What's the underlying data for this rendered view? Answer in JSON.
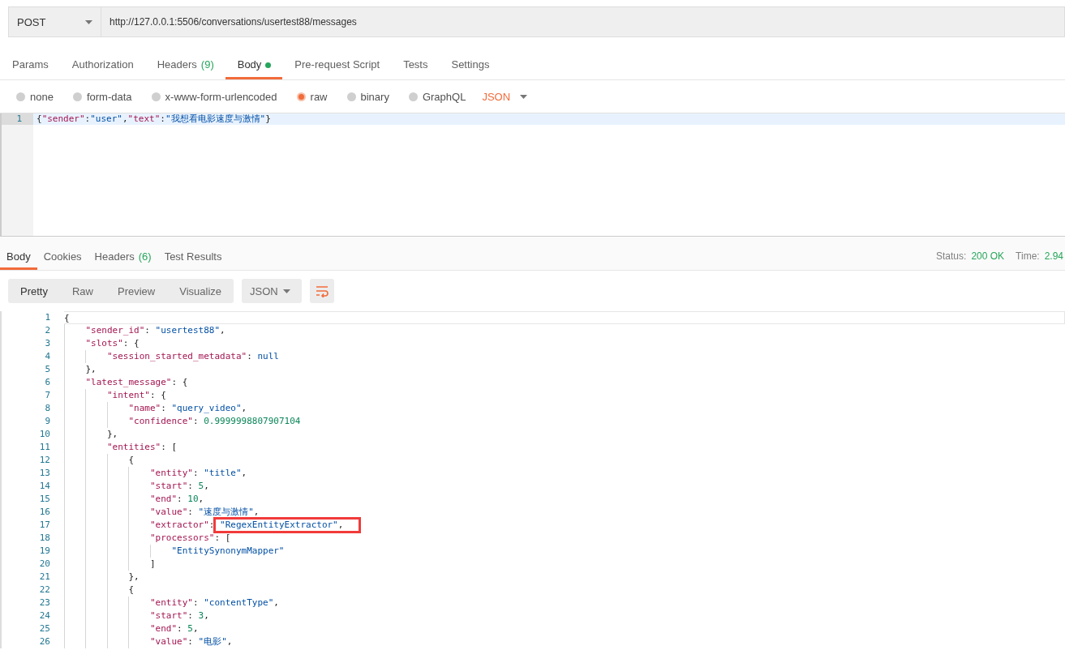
{
  "request": {
    "method": "POST",
    "url": "http://127.0.0.1:5506/conversations/usertest88/messages"
  },
  "request_tabs": [
    {
      "label": "Params",
      "selected": false
    },
    {
      "label": "Authorization",
      "selected": false
    },
    {
      "label": "Headers",
      "count": "(9)",
      "selected": false
    },
    {
      "label": "Body",
      "indicator": true,
      "selected": true
    },
    {
      "label": "Pre-request Script",
      "selected": false
    },
    {
      "label": "Tests",
      "selected": false
    },
    {
      "label": "Settings",
      "selected": false
    }
  ],
  "body_types": [
    {
      "label": "none",
      "selected": false
    },
    {
      "label": "form-data",
      "selected": false
    },
    {
      "label": "x-www-form-urlencoded",
      "selected": false
    },
    {
      "label": "raw",
      "selected": true
    },
    {
      "label": "binary",
      "selected": false
    },
    {
      "label": "GraphQL",
      "selected": false
    }
  ],
  "body_format": "JSON",
  "request_body": [
    {
      "number": "1",
      "tokens": [
        {
          "kind": "punct",
          "text": "{"
        },
        {
          "kind": "key",
          "text": "\"sender\""
        },
        {
          "kind": "punct",
          "text": ":"
        },
        {
          "kind": "string",
          "text": "\"user\""
        },
        {
          "kind": "punct",
          "text": ","
        },
        {
          "kind": "key",
          "text": "\"text\""
        },
        {
          "kind": "punct",
          "text": ":"
        },
        {
          "kind": "string",
          "text": "\"我想看电影速度与激情\""
        },
        {
          "kind": "punct",
          "text": "}"
        }
      ]
    }
  ],
  "response_tabs": [
    {
      "label": "Body",
      "selected": true
    },
    {
      "label": "Cookies",
      "selected": false
    },
    {
      "label": "Headers",
      "count": "(6)",
      "selected": false
    },
    {
      "label": "Test Results",
      "selected": false
    }
  ],
  "status": {
    "status_label": "Status:",
    "status_value": "200 OK",
    "time_label": "Time:",
    "time_value": "2.94"
  },
  "view_modes": [
    {
      "label": "Pretty",
      "selected": true
    },
    {
      "label": "Raw",
      "selected": false
    },
    {
      "label": "Preview",
      "selected": false
    },
    {
      "label": "Visualize",
      "selected": false
    }
  ],
  "response_format": "JSON",
  "response_body": [
    {
      "number": "1",
      "tokens": [
        {
          "kind": "punct",
          "text": "{"
        }
      ]
    },
    {
      "number": "2",
      "tokens": [
        {
          "kind": "key",
          "text": "    \"sender_id\""
        },
        {
          "kind": "punct",
          "text": ": "
        },
        {
          "kind": "string",
          "text": "\"usertest88\""
        },
        {
          "kind": "punct",
          "text": ","
        }
      ]
    },
    {
      "number": "3",
      "tokens": [
        {
          "kind": "key",
          "text": "    \"slots\""
        },
        {
          "kind": "punct",
          "text": ": {"
        }
      ]
    },
    {
      "number": "4",
      "tokens": [
        {
          "kind": "key",
          "text": "        \"session_started_metadata\""
        },
        {
          "kind": "punct",
          "text": ": "
        },
        {
          "kind": "null",
          "text": "null"
        }
      ]
    },
    {
      "number": "5",
      "tokens": [
        {
          "kind": "punct",
          "text": "    },"
        }
      ]
    },
    {
      "number": "6",
      "tokens": [
        {
          "kind": "key",
          "text": "    \"latest_message\""
        },
        {
          "kind": "punct",
          "text": ": {"
        }
      ]
    },
    {
      "number": "7",
      "tokens": [
        {
          "kind": "key",
          "text": "        \"intent\""
        },
        {
          "kind": "punct",
          "text": ": {"
        }
      ]
    },
    {
      "number": "8",
      "tokens": [
        {
          "kind": "key",
          "text": "            \"name\""
        },
        {
          "kind": "punct",
          "text": ": "
        },
        {
          "kind": "string",
          "text": "\"query_video\""
        },
        {
          "kind": "punct",
          "text": ","
        }
      ]
    },
    {
      "number": "9",
      "tokens": [
        {
          "kind": "key",
          "text": "            \"confidence\""
        },
        {
          "kind": "punct",
          "text": ": "
        },
        {
          "kind": "number",
          "text": "0.9999998807907104"
        }
      ]
    },
    {
      "number": "10",
      "tokens": [
        {
          "kind": "punct",
          "text": "        },"
        }
      ]
    },
    {
      "number": "11",
      "tokens": [
        {
          "kind": "key",
          "text": "        \"entities\""
        },
        {
          "kind": "punct",
          "text": ": ["
        }
      ]
    },
    {
      "number": "12",
      "tokens": [
        {
          "kind": "punct",
          "text": "            {"
        }
      ]
    },
    {
      "number": "13",
      "tokens": [
        {
          "kind": "key",
          "text": "                \"entity\""
        },
        {
          "kind": "punct",
          "text": ": "
        },
        {
          "kind": "string",
          "text": "\"title\""
        },
        {
          "kind": "punct",
          "text": ","
        }
      ]
    },
    {
      "number": "14",
      "tokens": [
        {
          "kind": "key",
          "text": "                \"start\""
        },
        {
          "kind": "punct",
          "text": ": "
        },
        {
          "kind": "number",
          "text": "5"
        },
        {
          "kind": "punct",
          "text": ","
        }
      ]
    },
    {
      "number": "15",
      "tokens": [
        {
          "kind": "key",
          "text": "                \"end\""
        },
        {
          "kind": "punct",
          "text": ": "
        },
        {
          "kind": "number",
          "text": "10"
        },
        {
          "kind": "punct",
          "text": ","
        }
      ]
    },
    {
      "number": "16",
      "tokens": [
        {
          "kind": "key",
          "text": "                \"value\""
        },
        {
          "kind": "punct",
          "text": ": "
        },
        {
          "kind": "string",
          "text": "\"速度与激情\""
        },
        {
          "kind": "punct",
          "text": ","
        }
      ]
    },
    {
      "number": "17",
      "tokens": [
        {
          "kind": "key",
          "text": "                \"extractor\""
        },
        {
          "kind": "punct",
          "text": ": "
        },
        {
          "kind": "string",
          "text": "\"RegexEntityExtractor\"",
          "boxed": true
        },
        {
          "kind": "punct",
          "text": ","
        }
      ]
    },
    {
      "number": "18",
      "tokens": [
        {
          "kind": "key",
          "text": "                \"processors\""
        },
        {
          "kind": "punct",
          "text": ": ["
        }
      ]
    },
    {
      "number": "19",
      "tokens": [
        {
          "kind": "string",
          "text": "                    \"EntitySynonymMapper\""
        }
      ]
    },
    {
      "number": "20",
      "tokens": [
        {
          "kind": "punct",
          "text": "                ]"
        }
      ]
    },
    {
      "number": "21",
      "tokens": [
        {
          "kind": "punct",
          "text": "            },"
        }
      ]
    },
    {
      "number": "22",
      "tokens": [
        {
          "kind": "punct",
          "text": "            {"
        }
      ]
    },
    {
      "number": "23",
      "tokens": [
        {
          "kind": "key",
          "text": "                \"entity\""
        },
        {
          "kind": "punct",
          "text": ": "
        },
        {
          "kind": "string",
          "text": "\"contentType\""
        },
        {
          "kind": "punct",
          "text": ","
        }
      ]
    },
    {
      "number": "24",
      "tokens": [
        {
          "kind": "key",
          "text": "                \"start\""
        },
        {
          "kind": "punct",
          "text": ": "
        },
        {
          "kind": "number",
          "text": "3"
        },
        {
          "kind": "punct",
          "text": ","
        }
      ]
    },
    {
      "number": "25",
      "tokens": [
        {
          "kind": "key",
          "text": "                \"end\""
        },
        {
          "kind": "punct",
          "text": ": "
        },
        {
          "kind": "number",
          "text": "5"
        },
        {
          "kind": "punct",
          "text": ","
        }
      ]
    },
    {
      "number": "26",
      "tokens": [
        {
          "kind": "key",
          "text": "                \"value\""
        },
        {
          "kind": "punct",
          "text": ": "
        },
        {
          "kind": "string",
          "text": "\"电影\""
        },
        {
          "kind": "punct",
          "text": ","
        }
      ]
    }
  ]
}
